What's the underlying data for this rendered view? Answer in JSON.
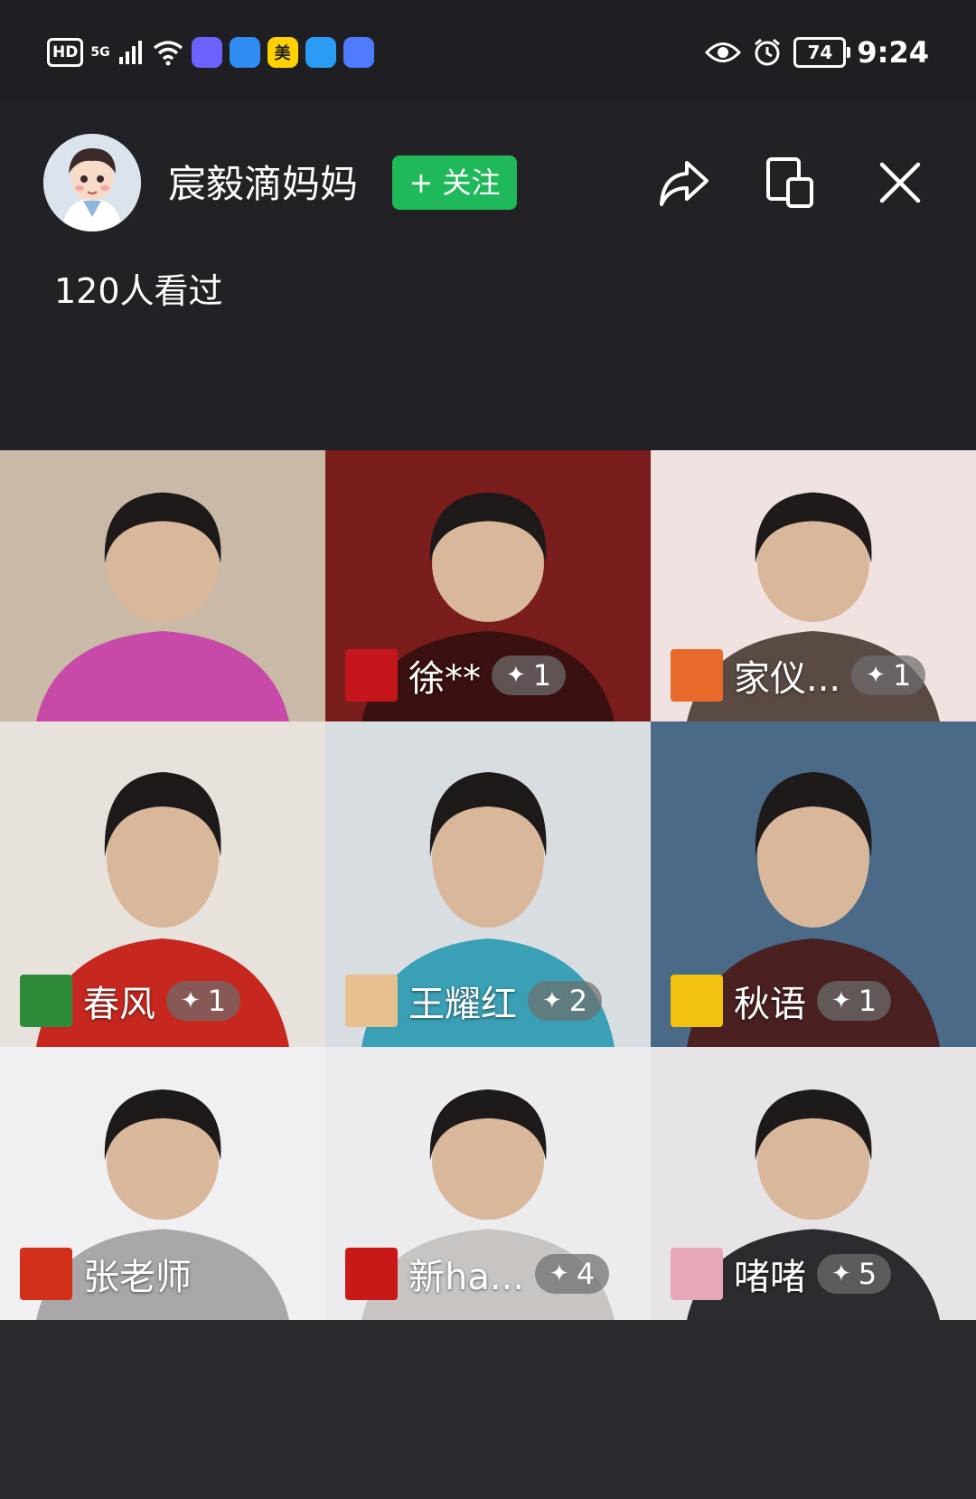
{
  "status_bar": {
    "hd": "HD",
    "network": "5G",
    "app_icons": [
      {
        "name": "education-app-icon",
        "color": "#6c63ff",
        "glyph": "▲"
      },
      {
        "name": "browser-app-icon",
        "color": "#2f8cf0",
        "glyph": "●"
      },
      {
        "name": "meituan-app-icon",
        "color": "#ffd100",
        "glyph": "美"
      },
      {
        "name": "cloud-app-icon",
        "color": "#2a9cf5",
        "glyph": "☁"
      },
      {
        "name": "music-app-icon",
        "color": "#4f7bff",
        "glyph": "♫"
      }
    ],
    "battery": "74",
    "time": "9:24"
  },
  "header": {
    "host_name": "宸毅滴妈妈",
    "follow_label": "+ 关注",
    "viewers": "120人看过"
  },
  "participants": [
    {
      "name": "",
      "likes": "",
      "bg": [
        "#c9b9a7",
        "#c74aa8"
      ],
      "avatar_color": ""
    },
    {
      "name": "徐**",
      "likes": "1",
      "bg": [
        "#7a1d1d",
        "#3a1010"
      ],
      "avatar_color": "#c4161c"
    },
    {
      "name": "家仪...",
      "likes": "1",
      "bg": [
        "#f0e2e0",
        "#5a4a44"
      ],
      "avatar_color": "#e86a2a"
    },
    {
      "name": "春风",
      "likes": "1",
      "bg": [
        "#e8e2dc",
        "#c6271f"
      ],
      "avatar_color": "#2d8b3a"
    },
    {
      "name": "王耀红",
      "likes": "2",
      "bg": [
        "#d8dde2",
        "#3aa0b5"
      ],
      "avatar_color": "#e8c090"
    },
    {
      "name": "秋语",
      "likes": "1",
      "bg": [
        "#4a6a88",
        "#4a2020"
      ],
      "avatar_color": "#f2c20f"
    },
    {
      "name": "张老师",
      "likes": "",
      "bg": [
        "#f0f0f2",
        "#a9a7a7"
      ],
      "avatar_color": "#d2301a"
    },
    {
      "name": "新ha...",
      "likes": "4",
      "bg": [
        "#ececee",
        "#c8c4c2"
      ],
      "avatar_color": "#c81818"
    },
    {
      "name": "啫啫",
      "likes": "5",
      "bg": [
        "#e6e4e6",
        "#2b2b30"
      ],
      "avatar_color": "#e8a7b8"
    }
  ],
  "like_glyph": "✦"
}
